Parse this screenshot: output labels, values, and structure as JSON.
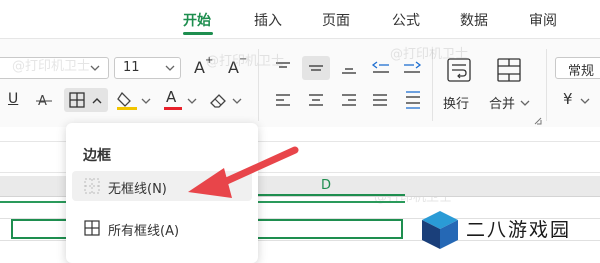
{
  "tabs": [
    {
      "label": "开始",
      "active": true
    },
    {
      "label": "插入",
      "active": false
    },
    {
      "label": "页面",
      "active": false
    },
    {
      "label": "公式",
      "active": false
    },
    {
      "label": "数据",
      "active": false
    },
    {
      "label": "审阅",
      "active": false
    }
  ],
  "ribbon": {
    "font_size": "11",
    "font_grow": "A",
    "font_shrink": "A",
    "underline": "U",
    "font_color_letter": "A",
    "wrap_label": "换行",
    "merge_label": "合并",
    "number_format": "常规",
    "currency_symbol": "¥"
  },
  "watermark": "@打印机卫士",
  "sheet": {
    "column_letter": "D"
  },
  "dropdown": {
    "title": "边框",
    "items": [
      {
        "label": "无框线(N)",
        "hover": true
      },
      {
        "label": "所有框线(A)",
        "hover": false
      }
    ]
  },
  "colors": {
    "accent": "#1e8e4f",
    "arrow": "#e8454a",
    "highlight_bar": "#f2c500",
    "font_color_bar": "#e8202a"
  },
  "brand": {
    "text": "二八游戏园"
  }
}
